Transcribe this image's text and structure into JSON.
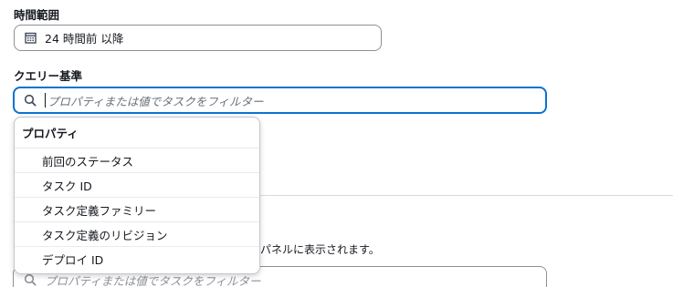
{
  "time_range": {
    "label": "時間範囲",
    "value": "24 時間前 以降"
  },
  "query": {
    "label": "クエリー基準",
    "placeholder": "プロパティまたは値でタスクをフィルター"
  },
  "dropdown": {
    "group_label": "プロパティ",
    "items": [
      "前回のステータス",
      "タスク ID",
      "タスク定義ファミリー",
      "タスク定義のリビジョン",
      "デプロイ ID"
    ]
  },
  "background": {
    "help_text_fragment": "パネルに表示されます。",
    "second_query_placeholder": "プロパティまたは値でタスクをフィルター"
  },
  "colors": {
    "focus_border": "#0972d3",
    "placeholder_text": "#687078"
  }
}
